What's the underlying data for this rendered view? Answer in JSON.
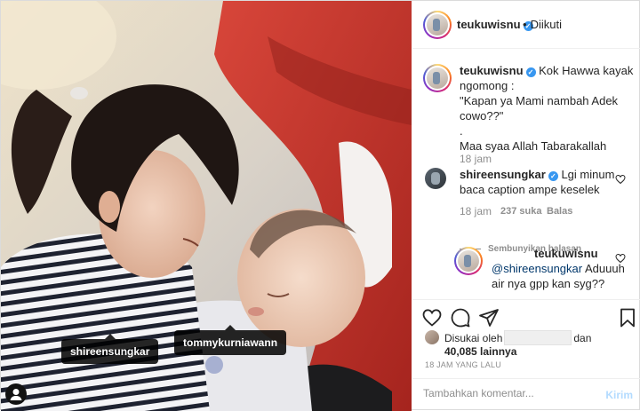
{
  "post": {
    "author": "teukuwisnu",
    "follow_status": "Diikuti",
    "separator": "•",
    "caption_lines": [
      "Kok Hawwa kayak",
      "ngomong :",
      "\"Kapan ya Mami nambah Adek",
      "cowo??\"",
      ".",
      "Maa syaa Allah Tabarakallah"
    ],
    "caption_time": "18 jam",
    "photo_tags": [
      "shireensungkar",
      "tommykurniawann"
    ]
  },
  "comments": [
    {
      "user": "shireensungkar",
      "verified": true,
      "text_lines": [
        "Lgi minum",
        "baca caption ampe keselek"
      ],
      "time": "18 jam",
      "likes": "237 suka",
      "reply_label": "Balas",
      "hide_replies": "Sembunyikan balasan"
    },
    {
      "user": "teukuwisnu",
      "mention": "@shireensungkar",
      "text_lines": [
        "Aduuuh",
        "air nya gpp kan syg??"
      ]
    }
  ],
  "likes": {
    "prefix": "Disukai oleh",
    "suffix": "dan",
    "count": "40,085 lainnya"
  },
  "timestamp": "18 JAM YANG LALU",
  "add_comment": {
    "placeholder": "Tambahkan komentar...",
    "post_label": "Kirim"
  },
  "colors": {
    "verified": "#3897f0",
    "post_disabled": "#b3dbff",
    "muted": "#8e8e8e",
    "stroller": "#c8372d"
  },
  "icons": [
    "heart-icon",
    "comment-icon",
    "share-icon",
    "bookmark-icon",
    "user-tag-icon",
    "verified-icon"
  ]
}
